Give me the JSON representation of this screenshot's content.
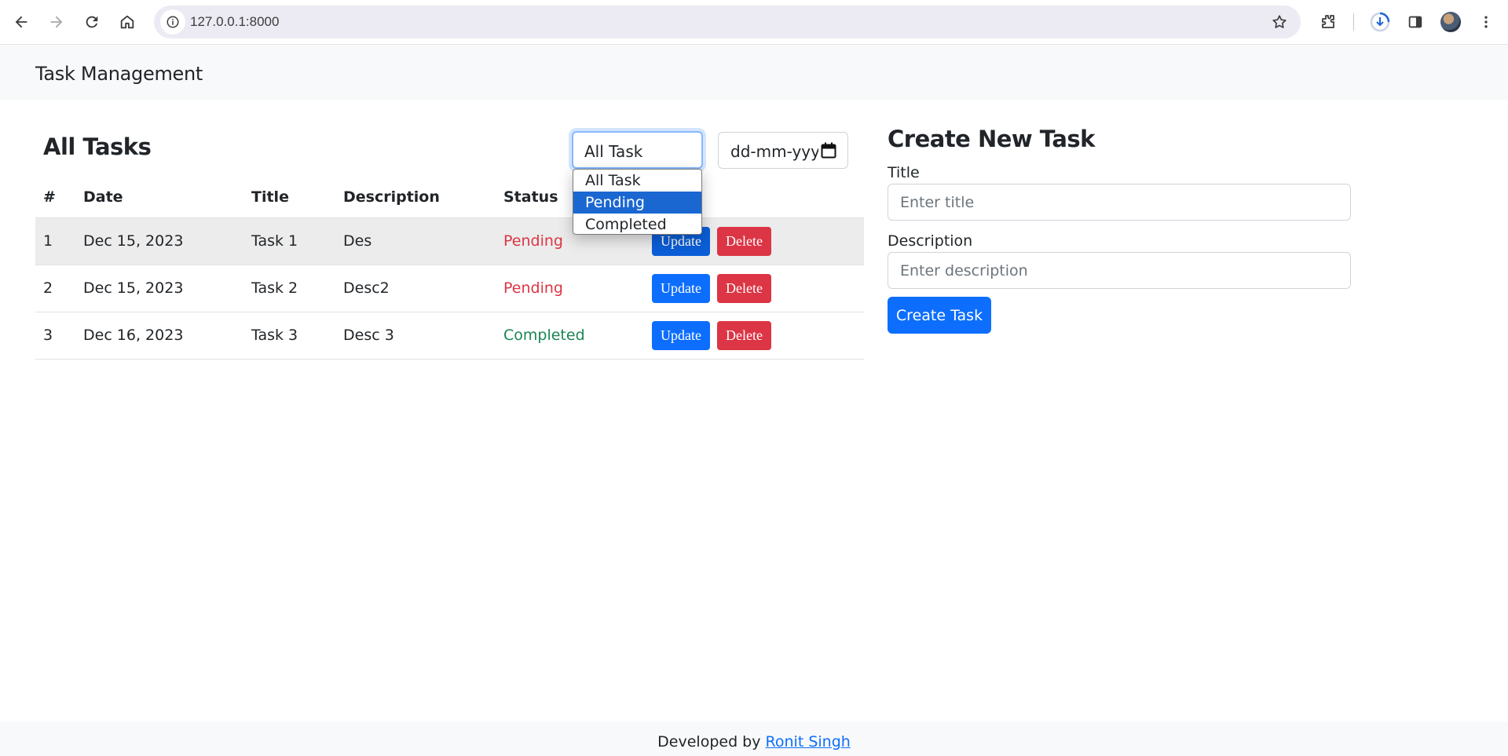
{
  "browser": {
    "url": "127.0.0.1:8000"
  },
  "navbar": {
    "brand": "Task Management"
  },
  "tasks_panel": {
    "heading": "All Tasks",
    "filter": {
      "selected": "All Task",
      "options": [
        "All Task",
        "Pending",
        "Completed"
      ],
      "highlighted": "Pending"
    },
    "date_filter": {
      "placeholder": "dd-mm-yyyy"
    },
    "columns": [
      "#",
      "Date",
      "Title",
      "Description",
      "Status",
      ""
    ],
    "rows": [
      {
        "num": "1",
        "date": "Dec 15, 2023",
        "title": "Task 1",
        "description": "Des",
        "status": "Pending"
      },
      {
        "num": "2",
        "date": "Dec 15, 2023",
        "title": "Task 2",
        "description": "Desc2",
        "status": "Pending"
      },
      {
        "num": "3",
        "date": "Dec 16, 2023",
        "title": "Task 3",
        "description": "Desc 3",
        "status": "Completed"
      }
    ],
    "update_label": "Update",
    "delete_label": "Delete"
  },
  "create_panel": {
    "heading": "Create New Task",
    "title_label": "Title",
    "title_placeholder": "Enter title",
    "description_label": "Description",
    "description_placeholder": "Enter description",
    "submit_label": "Create Task"
  },
  "footer": {
    "text": "Developed by",
    "author": "Ronit Singh"
  },
  "colors": {
    "primary": "#0d6efd",
    "danger": "#dc3545",
    "success": "#198754"
  }
}
